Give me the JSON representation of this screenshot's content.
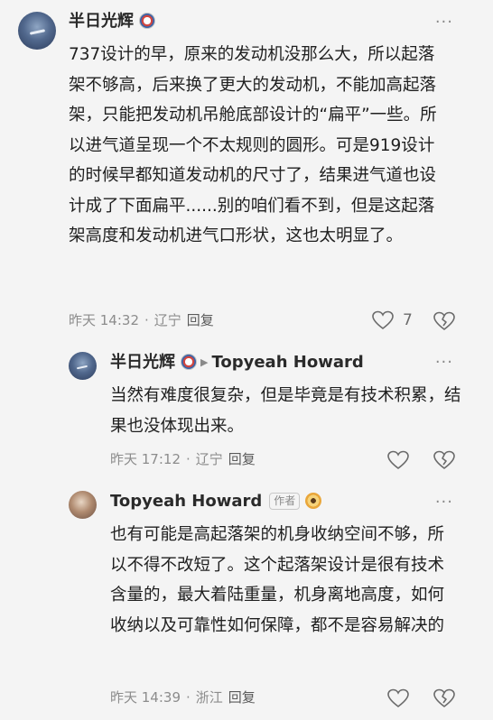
{
  "comments": [
    {
      "user": "半日光辉",
      "text": "737设计的早，原来的发动机没那么大，所以起落架不够高，后来换了更大的发动机，不能加高起落架，只能把发动机吊舱底部设计的“扁平”一些。所以进气道呈现一个不太规则的圆形。可是919设计的时候早都知道发动机的尺寸了，结果进气道也设计成了下面扁平......别的咱们看不到，但是这起落架高度和发动机进气口形状，这也太明显了。",
      "time": "昨天 14:32",
      "location": "辽宁",
      "reply_label": "回复",
      "likes": "7"
    },
    {
      "user": "半日光辉",
      "reply_to": "Topyeah Howard",
      "text": "当然有难度很复杂，但是毕竟是有技术积累，结果也没体现出来。",
      "time": "昨天 17:12",
      "location": "辽宁",
      "reply_label": "回复"
    },
    {
      "user": "Topyeah Howard",
      "author_tag": "作者",
      "text": "也有可能是高起落架的机身收纳空间不够，所以不得不改短了。这个起落架设计是很有技术含量的，最大着陆重量，机身离地高度，如何收纳以及可靠性如何保障，都不是容易解决的",
      "time": "昨天 14:39",
      "location": "浙江",
      "reply_label": "回复"
    }
  ],
  "icons": {
    "more": "more-dots-icon",
    "like": "heart-outline-icon",
    "share": "heart-broken-icon",
    "reply_arrow": "triangle-right-icon"
  },
  "colors": {
    "background": "#f4f4f4",
    "username": "#2a2a2a",
    "meta": "#8c8c8c"
  }
}
